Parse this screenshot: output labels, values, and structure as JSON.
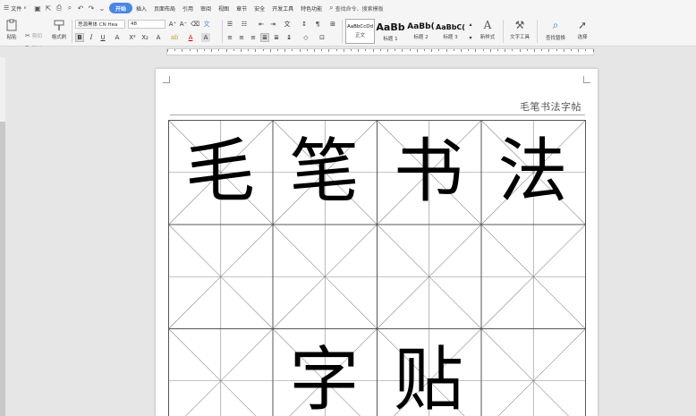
{
  "menubar": {
    "file_label": "文件",
    "tabs": [
      {
        "label": "开始",
        "active": true
      },
      {
        "label": "插入",
        "active": false
      },
      {
        "label": "页面布局",
        "active": false
      },
      {
        "label": "引用",
        "active": false
      },
      {
        "label": "审阅",
        "active": false
      },
      {
        "label": "视图",
        "active": false
      },
      {
        "label": "章节",
        "active": false
      },
      {
        "label": "安全",
        "active": false
      },
      {
        "label": "开发工具",
        "active": false
      },
      {
        "label": "特色功能",
        "active": false
      }
    ],
    "search_label": "查找命令、搜索模板"
  },
  "ribbon": {
    "paste_label": "粘贴",
    "cut_label": "剪切",
    "copy_label": "复制",
    "format_painter_label": "格式刷",
    "font_name": "思源黑体 CN Hea",
    "font_size": "48",
    "bold": "B",
    "italic": "I",
    "underline": "U",
    "styles": [
      {
        "sample": "AaBbCcDd",
        "label": "正文"
      },
      {
        "sample": "AaBb",
        "label": "标题 1"
      },
      {
        "sample": "AaBb(",
        "label": "标题 2"
      },
      {
        "sample": "AaBbC(",
        "label": "标题 3"
      }
    ],
    "new_style_label": "新样式",
    "text_tools_label": "文字工具",
    "find_replace_label": "查找替换",
    "select_label": "选择"
  },
  "document": {
    "header_text": "毛笔书法字帖",
    "grid_chars": [
      {
        "row": 0,
        "col": 0,
        "char": "毛"
      },
      {
        "row": 0,
        "col": 1,
        "char": "笔"
      },
      {
        "row": 0,
        "col": 2,
        "char": "书"
      },
      {
        "row": 0,
        "col": 3,
        "char": "法"
      },
      {
        "row": 2,
        "col": 1,
        "char": "字"
      },
      {
        "row": 2,
        "col": 2,
        "char": "贴"
      }
    ]
  },
  "colors": {
    "accent": "#4a86e8",
    "grid_line": "#555555",
    "guide_line": "#888888"
  }
}
